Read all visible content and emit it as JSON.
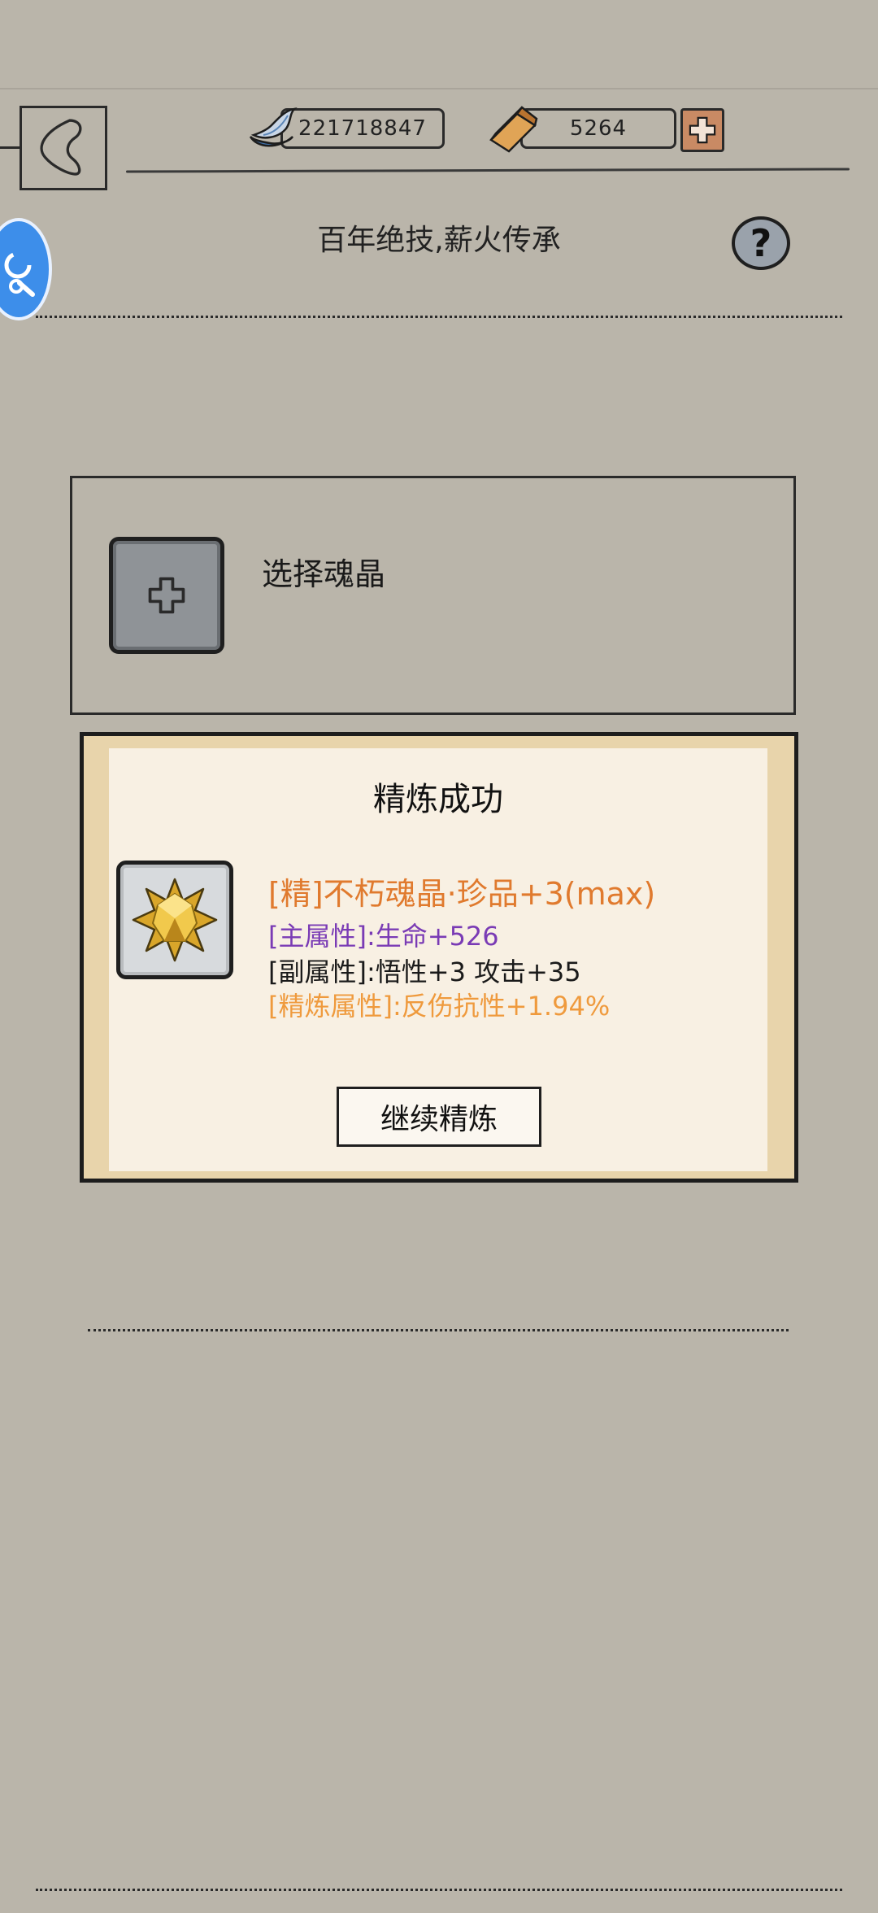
{
  "header": {
    "silver_amount": "221718847",
    "gold_amount": "5264",
    "silver_icon": "silver-ingot-icon",
    "gold_icon": "gold-bar-icon"
  },
  "page": {
    "title": "百年绝技,薪火传承",
    "help_symbol": "?"
  },
  "select_panel": {
    "label": "选择魂晶"
  },
  "result_dialog": {
    "title": "精炼成功",
    "item_name": "[精]不朽魂晶·珍品+3(max)",
    "main_stat": "[主属性]:生命+526",
    "sub_stat": "[副属性]:悟性+3 攻击+35",
    "refine_stat": "[精炼属性]:反伤抗性+1.94%",
    "continue_label": "继续精炼",
    "item_icon": "gold-star-crystal-icon"
  },
  "colors": {
    "background": "#bab5aa",
    "item_name": "#e07a2e",
    "main_stat": "#7a3bb5",
    "refine_stat": "#ef9a3d",
    "accent_blue": "#3d8eea"
  }
}
